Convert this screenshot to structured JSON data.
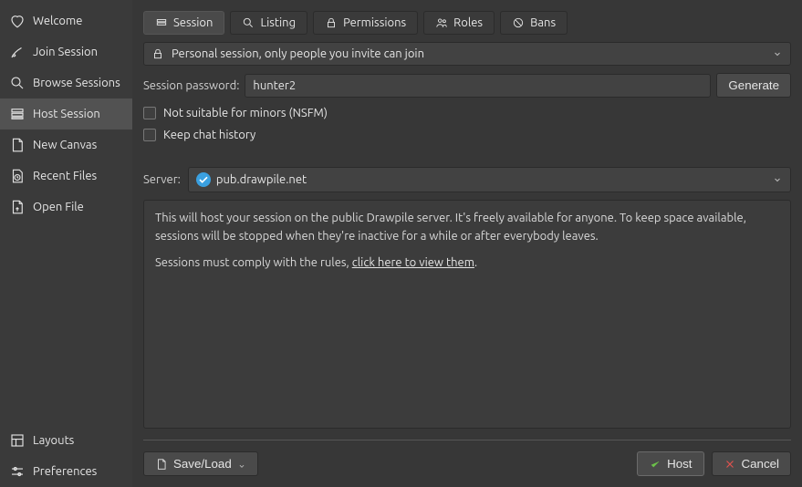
{
  "sidebar": {
    "top_items": [
      {
        "label": "Welcome"
      },
      {
        "label": "Join Session"
      },
      {
        "label": "Browse Sessions"
      },
      {
        "label": "Host Session"
      },
      {
        "label": "New Canvas"
      },
      {
        "label": "Recent Files"
      },
      {
        "label": "Open File"
      }
    ],
    "bottom_items": [
      {
        "label": "Layouts"
      },
      {
        "label": "Preferences"
      }
    ]
  },
  "tabs": {
    "session": "Session",
    "listing": "Listing",
    "permissions": "Permissions",
    "roles": "Roles",
    "bans": "Bans"
  },
  "privacy_select": "Personal session, only people you invite can join",
  "password": {
    "label": "Session password:",
    "value": "hunter2",
    "generate": "Generate"
  },
  "checkboxes": {
    "nsfm": "Not suitable for minors (NSFM)",
    "keep_chat": "Keep chat history"
  },
  "server": {
    "label": "Server:",
    "value": "pub.drawpile.net"
  },
  "info": {
    "p1": "This will host your session on the public Drawpile server. It's freely available for anyone. To keep space available, sessions will be stopped when they're inactive for a while or after everybody leaves.",
    "p2_prefix": "Sessions must comply with the rules, ",
    "p2_link": "click here to view them",
    "p2_suffix": "."
  },
  "footer": {
    "save_load": "Save/Load",
    "host": "Host",
    "cancel": "Cancel"
  }
}
